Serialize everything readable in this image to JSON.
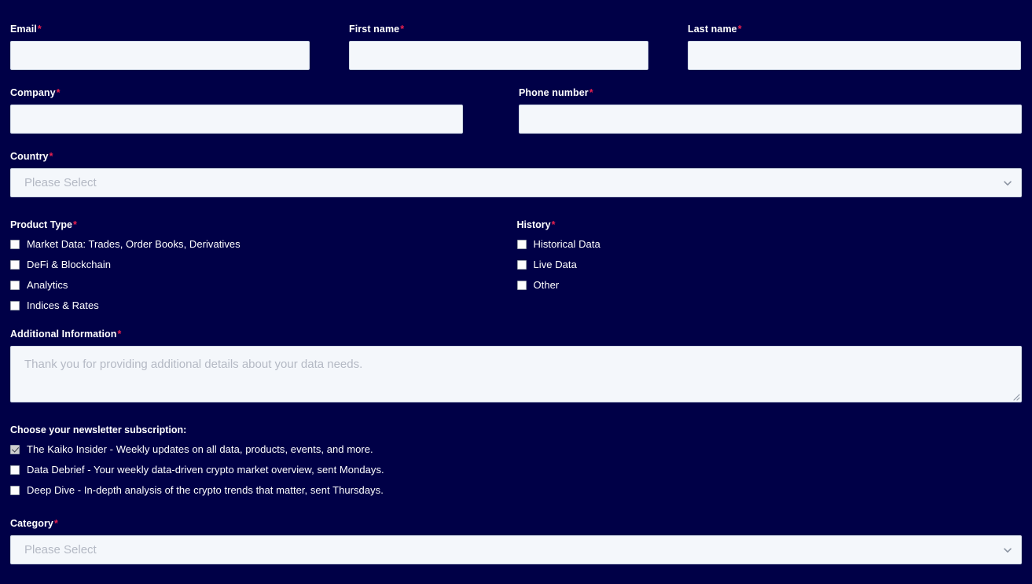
{
  "form": {
    "required_marker": "*",
    "fields": {
      "email": {
        "label": "Email",
        "value": "",
        "placeholder": ""
      },
      "first_name": {
        "label": "First name",
        "value": "",
        "placeholder": ""
      },
      "last_name": {
        "label": "Last name",
        "value": "",
        "placeholder": ""
      },
      "company": {
        "label": "Company",
        "value": "",
        "placeholder": ""
      },
      "phone_number": {
        "label": "Phone number",
        "value": "",
        "placeholder": ""
      },
      "country": {
        "label": "Country",
        "selected": "Please Select"
      },
      "additional_information": {
        "label": "Additional Information",
        "value": "",
        "placeholder": "Thank you for providing additional details about your data needs."
      },
      "category": {
        "label": "Category",
        "selected": "Please Select"
      }
    },
    "product_type": {
      "label": "Product Type",
      "options": [
        {
          "label": "Market Data: Trades, Order Books, Derivatives",
          "checked": false
        },
        {
          "label": "DeFi & Blockchain",
          "checked": false
        },
        {
          "label": "Analytics",
          "checked": false
        },
        {
          "label": "Indices & Rates",
          "checked": false
        }
      ]
    },
    "history": {
      "label": "History",
      "options": [
        {
          "label": "Historical Data",
          "checked": false
        },
        {
          "label": "Live Data",
          "checked": false
        },
        {
          "label": "Other",
          "checked": false
        }
      ]
    },
    "newsletter": {
      "heading": "Choose your newsletter subscription:",
      "options": [
        {
          "label": "The Kaiko Insider - Weekly updates on all data, products, events, and more.",
          "checked": true
        },
        {
          "label": "Data Debrief - Your weekly data-driven crypto market overview, sent Mondays.",
          "checked": false
        },
        {
          "label": "Deep Dive - In-depth analysis of the crypto trends that matter, sent Thursdays.",
          "checked": false
        }
      ]
    },
    "icons": {
      "chevron": "chevron-down-icon",
      "resize": "resize-grip-icon"
    },
    "colors": {
      "background": "#000047",
      "input_background": "#f4f7fb",
      "required_asterisk": "#e8204e",
      "placeholder": "#b4b9c4"
    }
  }
}
